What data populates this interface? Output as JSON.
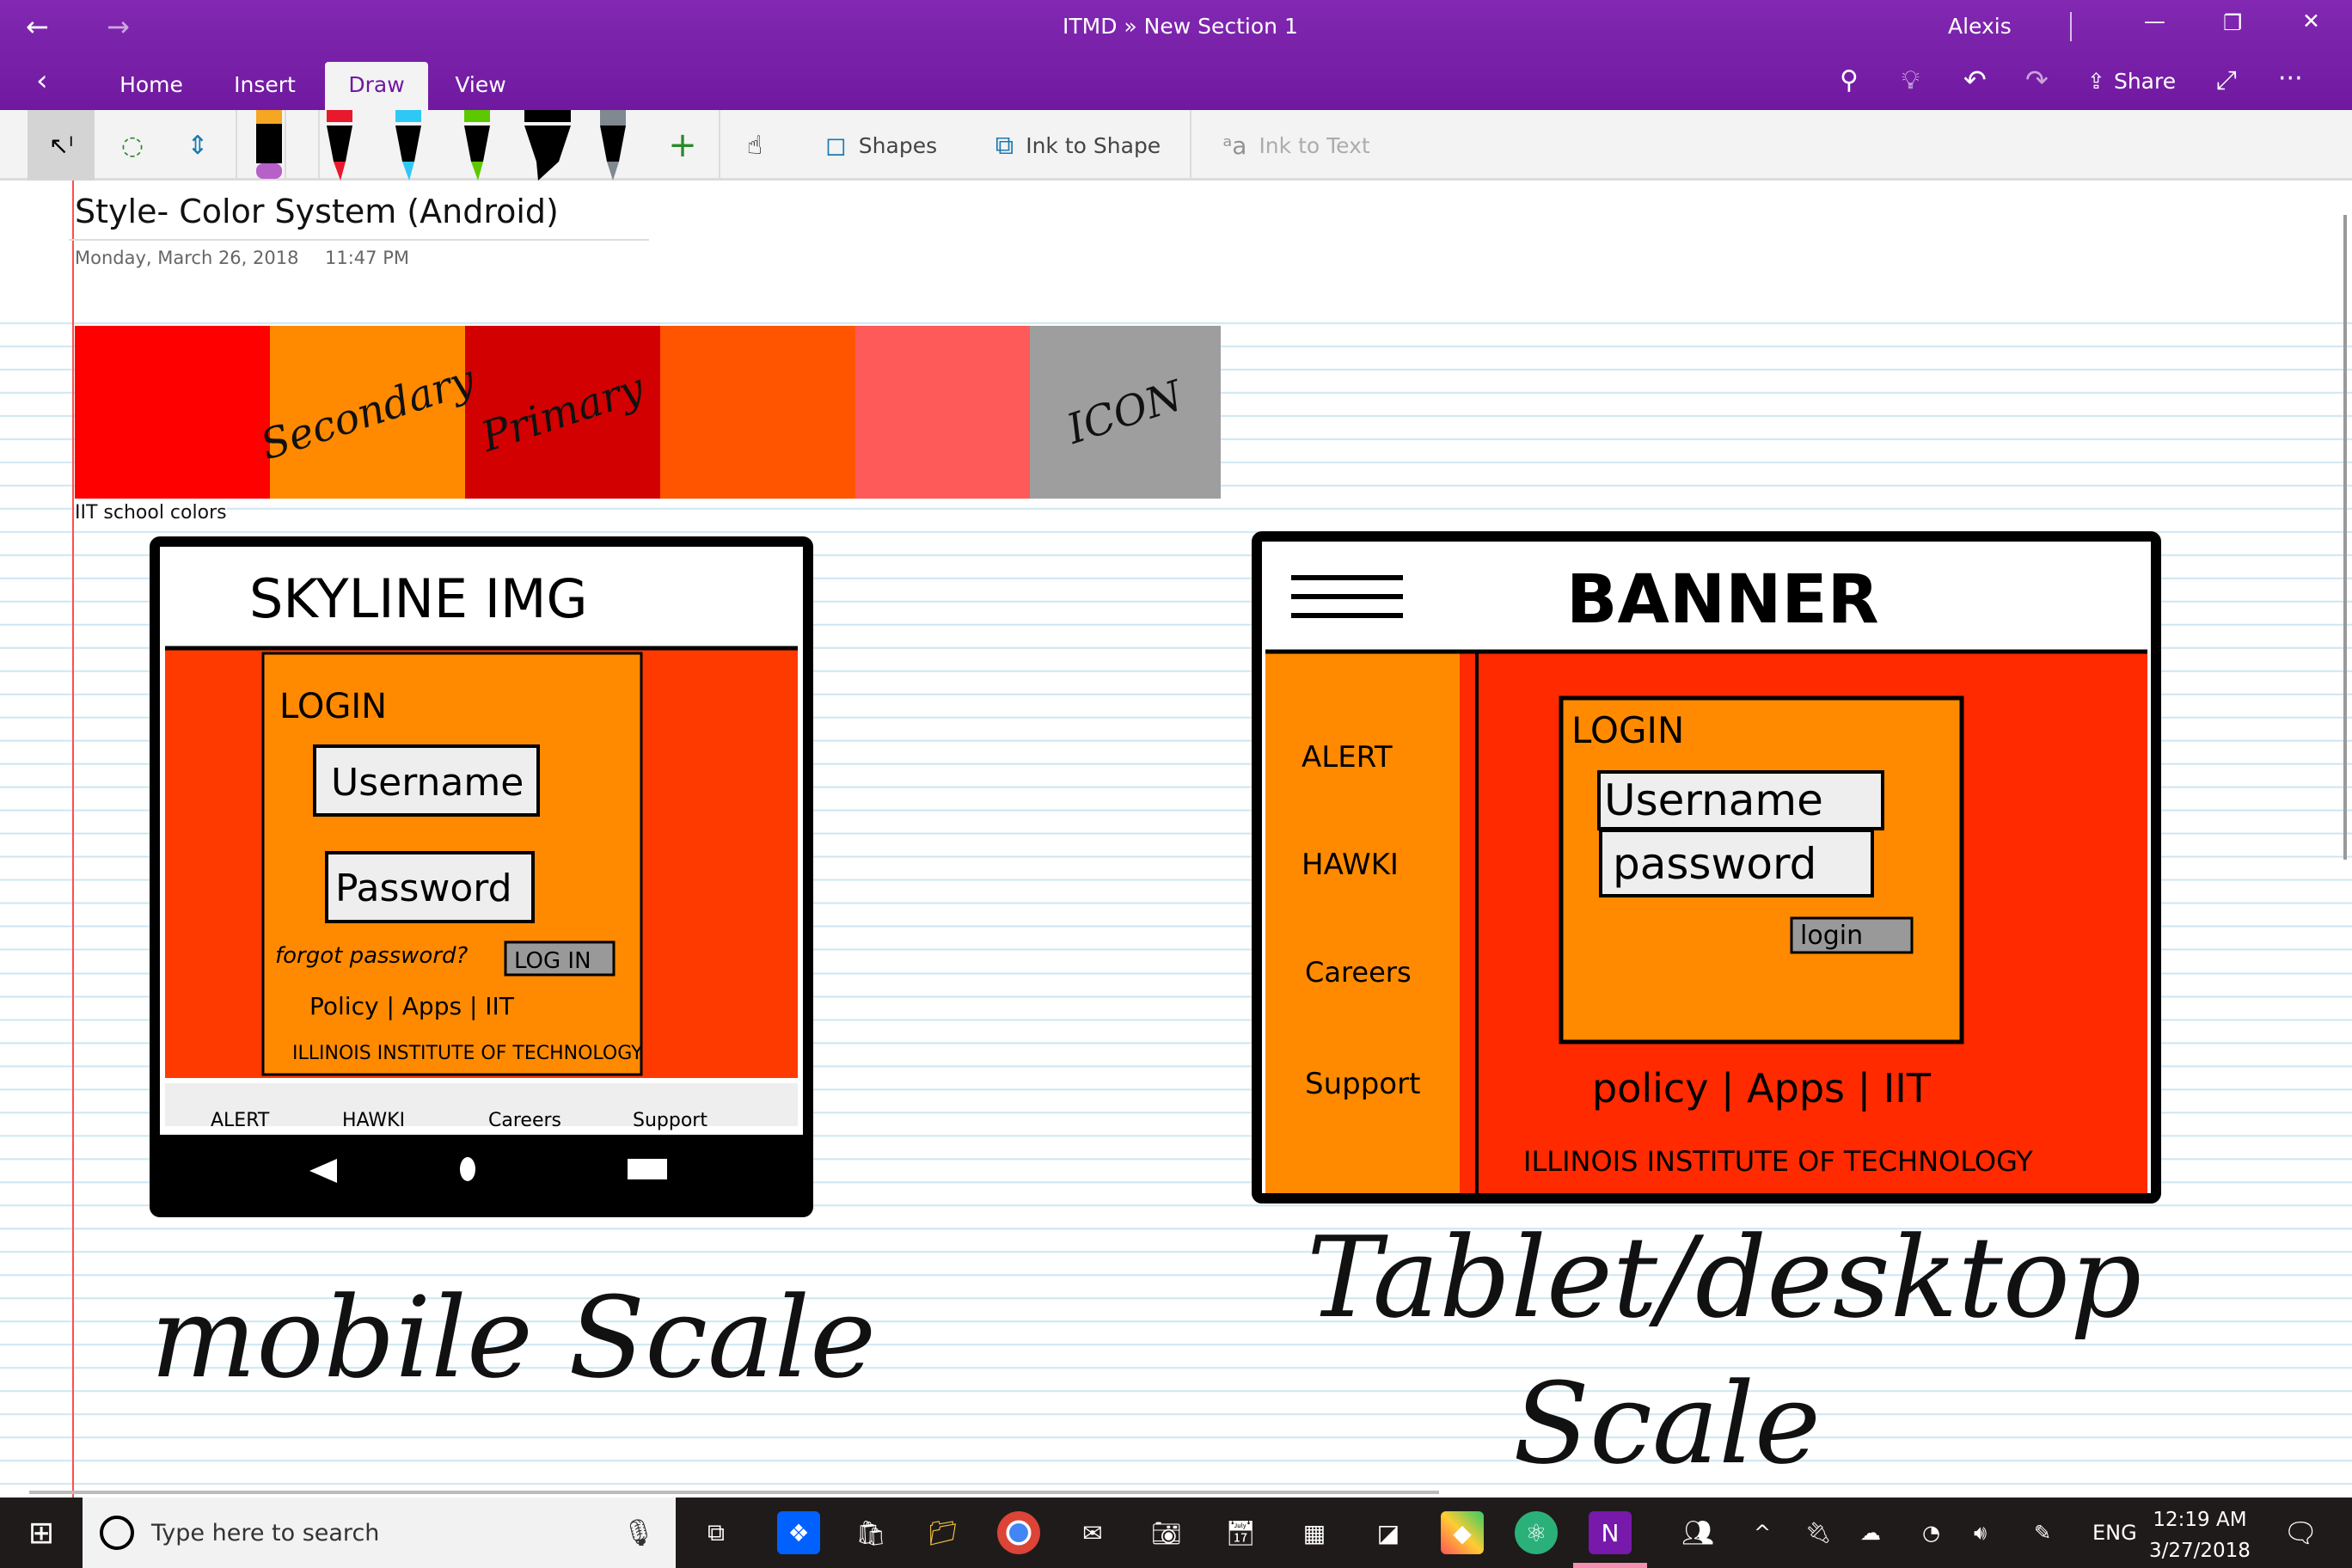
{
  "window": {
    "title": "ITMD » New Section 1",
    "user": "Alexis"
  },
  "ribbon": {
    "tabs": [
      {
        "label": "Home"
      },
      {
        "label": "Insert"
      },
      {
        "label": "Draw",
        "active": true
      },
      {
        "label": "View"
      }
    ],
    "share_label": "Share"
  },
  "toolbar": {
    "shapes_label": "Shapes",
    "ink_to_shape_label": "Ink to Shape",
    "ink_to_text_label": "Ink to Text",
    "pens": [
      {
        "type": "highlighter",
        "color": "#F5A623",
        "tip": "#B660C8"
      },
      {
        "type": "pen",
        "color": "#E8192C"
      },
      {
        "type": "pen",
        "color": "#2EC8F5"
      },
      {
        "type": "pen",
        "color": "#5CC800"
      },
      {
        "type": "marker",
        "color": "#000000"
      },
      {
        "type": "pencil",
        "color": "#808890"
      }
    ]
  },
  "page": {
    "title": "Style- Color System (Android)",
    "date": "Monday, March 26, 2018",
    "time": "11:47 PM",
    "swatches": [
      {
        "color": "#FF0000",
        "label": ""
      },
      {
        "color": "#FF8A00",
        "label": "Secondary"
      },
      {
        "color": "#D20000",
        "label": "Primary"
      },
      {
        "color": "#FF5500",
        "label": ""
      },
      {
        "color": "#FF5A5A",
        "label": ""
      },
      {
        "color": "#9E9E9E",
        "label": "ICON"
      }
    ],
    "swatch_caption": "IIT school colors",
    "mobile": {
      "header": "SKYLINE IMG",
      "login": "LOGIN",
      "username": "Username",
      "password": "Password",
      "forgot": "forgot password?",
      "login_button": "LOG IN",
      "footer_links": "Policy | Apps | IIT",
      "footer_name": "ILLINOIS INSTITUTE OF TECHNOLOGY",
      "nav": [
        "ALERT",
        "HAWKI",
        "Careers",
        "Support"
      ],
      "caption": "mobile Scale"
    },
    "tablet": {
      "header": "BANNER",
      "login": "LOGIN",
      "username": "Username",
      "password": "password",
      "login_button": "login",
      "nav": [
        "ALERT",
        "HAWKI",
        "Careers",
        "Support"
      ],
      "footer_links": "policy | Apps | IIT",
      "footer_name": "ILLINOIS INSTITUTE OF TECHNOLOGY",
      "caption_line1": "Tablet/desktop",
      "caption_line2": "Scale"
    }
  },
  "taskbar": {
    "search_placeholder": "Type here to search",
    "language": "ENG",
    "time": "12:19 AM",
    "date": "3/27/2018"
  }
}
